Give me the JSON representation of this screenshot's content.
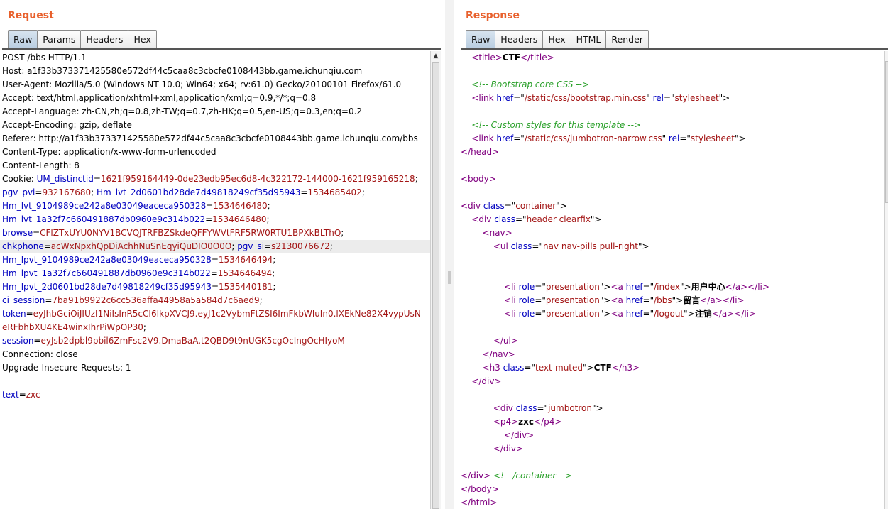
{
  "request": {
    "title": "Request",
    "tabs": [
      {
        "label": "Raw",
        "active": true
      },
      {
        "label": "Params",
        "active": false
      },
      {
        "label": "Headers",
        "active": false
      },
      {
        "label": "Hex",
        "active": false
      }
    ],
    "lines": [
      [
        {
          "t": "POST /bbs HTTP/1.1",
          "c": "plain"
        }
      ],
      [
        {
          "t": "Host: a1f33b373371425580e572df44c5caa8c3cbcfe0108443bb.game.ichunqiu.com",
          "c": "plain"
        }
      ],
      [
        {
          "t": "User-Agent: Mozilla/5.0 (Windows NT 10.0; Win64; x64; rv:61.0) Gecko/20100101 Firefox/61.0",
          "c": "plain"
        }
      ],
      [
        {
          "t": "Accept: text/html,application/xhtml+xml,application/xml;q=0.9,*/*;q=0.8",
          "c": "plain"
        }
      ],
      [
        {
          "t": "Accept-Language: zh-CN,zh;q=0.8,zh-TW;q=0.7,zh-HK;q=0.5,en-US;q=0.3,en;q=0.2",
          "c": "plain"
        }
      ],
      [
        {
          "t": "Accept-Encoding: gzip, deflate",
          "c": "plain"
        }
      ],
      [
        {
          "t": "Referer: http://a1f33b373371425580e572df44c5caa8c3cbcfe0108443bb.game.ichunqiu.com/bbs",
          "c": "plain"
        }
      ],
      [
        {
          "t": "Content-Type: application/x-www-form-urlencoded",
          "c": "plain"
        }
      ],
      [
        {
          "t": "Content-Length: 8",
          "c": "plain"
        }
      ],
      [
        {
          "t": "Cookie: ",
          "c": "plain"
        },
        {
          "t": "UM_distinctid",
          "c": "k"
        },
        {
          "t": "=",
          "c": "plain"
        },
        {
          "t": "1621f959164449-0de23edb95ec6d8-4c322172-144000-1621f959165218",
          "c": "v"
        },
        {
          "t": ";",
          "c": "plain"
        }
      ],
      [
        {
          "t": "pgv_pvi",
          "c": "k"
        },
        {
          "t": "=",
          "c": "plain"
        },
        {
          "t": "932167680",
          "c": "v"
        },
        {
          "t": "; ",
          "c": "plain"
        },
        {
          "t": "Hm_lvt_2d0601bd28de7d49818249cf35d95943",
          "c": "k"
        },
        {
          "t": "=",
          "c": "plain"
        },
        {
          "t": "1534685402",
          "c": "v"
        },
        {
          "t": ";",
          "c": "plain"
        }
      ],
      [
        {
          "t": "Hm_lvt_9104989ce242a8e03049eaceca950328",
          "c": "k"
        },
        {
          "t": "=",
          "c": "plain"
        },
        {
          "t": "1534646480",
          "c": "v"
        },
        {
          "t": ";",
          "c": "plain"
        }
      ],
      [
        {
          "t": "Hm_lvt_1a32f7c660491887db0960e9c314b022",
          "c": "k"
        },
        {
          "t": "=",
          "c": "plain"
        },
        {
          "t": "1534646480",
          "c": "v"
        },
        {
          "t": ";",
          "c": "plain"
        }
      ],
      [
        {
          "t": "browse",
          "c": "k"
        },
        {
          "t": "=",
          "c": "plain"
        },
        {
          "t": "CFlZTxUYU0NYV1BCVQJTRFBZSkdeQFFYWVtFRF5RW0RTU1BPXkBLThQ",
          "c": "v"
        },
        {
          "t": ";",
          "c": "plain"
        }
      ],
      [
        {
          "t": "chkphone",
          "c": "k"
        },
        {
          "t": "=",
          "c": "plain"
        },
        {
          "t": "acWxNpxhQpDiAchhNuSnEqyiQuDIO0O0O",
          "c": "v"
        },
        {
          "t": "; ",
          "c": "plain"
        },
        {
          "t": "pgv_si",
          "c": "k"
        },
        {
          "t": "=",
          "c": "plain"
        },
        {
          "t": "s2130076672",
          "c": "v"
        },
        {
          "t": ";",
          "c": "plain"
        }
      ],
      [
        {
          "t": "Hm_lpvt_9104989ce242a8e03049eaceca950328",
          "c": "k"
        },
        {
          "t": "=",
          "c": "plain"
        },
        {
          "t": "1534646494",
          "c": "v"
        },
        {
          "t": ";",
          "c": "plain"
        }
      ],
      [
        {
          "t": "Hm_lpvt_1a32f7c660491887db0960e9c314b022",
          "c": "k"
        },
        {
          "t": "=",
          "c": "plain"
        },
        {
          "t": "1534646494",
          "c": "v"
        },
        {
          "t": ";",
          "c": "plain"
        }
      ],
      [
        {
          "t": "Hm_lpvt_2d0601bd28de7d49818249cf35d95943",
          "c": "k"
        },
        {
          "t": "=",
          "c": "plain"
        },
        {
          "t": "1535440181",
          "c": "v"
        },
        {
          "t": ";",
          "c": "plain"
        }
      ],
      [
        {
          "t": "ci_session",
          "c": "k"
        },
        {
          "t": "=",
          "c": "plain"
        },
        {
          "t": "7ba91b9922c6cc536affa44958a5a584d7c6aed9",
          "c": "v"
        },
        {
          "t": ";",
          "c": "plain"
        }
      ],
      [
        {
          "t": "token",
          "c": "k"
        },
        {
          "t": "=",
          "c": "plain"
        },
        {
          "t": "eyJhbGciOiJIUzI1NiIsInR5cCI6IkpXVCJ9.eyJ1c2VybmFtZSI6ImFkbWluIn0.lXEkNe82X4vypUsN",
          "c": "v"
        }
      ],
      [
        {
          "t": "eRFbhbXU4KE4winxIhrPiWpOP30",
          "c": "v"
        },
        {
          "t": ";",
          "c": "plain"
        }
      ],
      [
        {
          "t": "session",
          "c": "k"
        },
        {
          "t": "=",
          "c": "plain"
        },
        {
          "t": "eyJsb2dpbl9pbil6ZmFsc2V9.DmaBaA.t2QBD9t9nUGK5cgOcIngOcHIyoM",
          "c": "v"
        }
      ],
      [
        {
          "t": "Connection: close",
          "c": "plain"
        }
      ],
      [
        {
          "t": "Upgrade-Insecure-Requests: 1",
          "c": "plain"
        }
      ],
      [
        {
          "t": "",
          "c": "plain"
        }
      ],
      [
        {
          "t": "text",
          "c": "k"
        },
        {
          "t": "=",
          "c": "plain"
        },
        {
          "t": "zxc",
          "c": "v"
        }
      ]
    ]
  },
  "response": {
    "title": "Response",
    "tabs": [
      {
        "label": "Raw",
        "active": true
      },
      {
        "label": "Headers",
        "active": false
      },
      {
        "label": "Hex",
        "active": false
      },
      {
        "label": "HTML",
        "active": false
      },
      {
        "label": "Render",
        "active": false
      }
    ],
    "lines": [
      [
        {
          "t": "    ",
          "c": "plain"
        },
        {
          "t": "<title>",
          "c": "tag"
        },
        {
          "t": "CTF",
          "c": "bold"
        },
        {
          "t": "</title>",
          "c": "tag"
        }
      ],
      [
        {
          "t": "",
          "c": "plain"
        }
      ],
      [
        {
          "t": "    ",
          "c": "plain"
        },
        {
          "t": "<!-- Bootstrap core CSS -->",
          "c": "cmt"
        }
      ],
      [
        {
          "t": "    ",
          "c": "plain"
        },
        {
          "t": "<link ",
          "c": "tag"
        },
        {
          "t": "href",
          "c": "attr"
        },
        {
          "t": "=\"",
          "c": "plain"
        },
        {
          "t": "/static/css/bootstrap.min.css",
          "c": "aval"
        },
        {
          "t": "\" ",
          "c": "plain"
        },
        {
          "t": "rel",
          "c": "attr"
        },
        {
          "t": "=\"",
          "c": "plain"
        },
        {
          "t": "stylesheet",
          "c": "aval"
        },
        {
          "t": "\">",
          "c": "plain"
        }
      ],
      [
        {
          "t": "",
          "c": "plain"
        }
      ],
      [
        {
          "t": "    ",
          "c": "plain"
        },
        {
          "t": "<!-- Custom styles for this template -->",
          "c": "cmt"
        }
      ],
      [
        {
          "t": "    ",
          "c": "plain"
        },
        {
          "t": "<link ",
          "c": "tag"
        },
        {
          "t": "href",
          "c": "attr"
        },
        {
          "t": "=\"",
          "c": "plain"
        },
        {
          "t": "/static/css/jumbotron-narrow.css",
          "c": "aval"
        },
        {
          "t": "\" ",
          "c": "plain"
        },
        {
          "t": "rel",
          "c": "attr"
        },
        {
          "t": "=\"",
          "c": "plain"
        },
        {
          "t": "stylesheet",
          "c": "aval"
        },
        {
          "t": "\">",
          "c": "plain"
        }
      ],
      [
        {
          "t": "</head>",
          "c": "tag"
        }
      ],
      [
        {
          "t": "",
          "c": "plain"
        }
      ],
      [
        {
          "t": "<body>",
          "c": "tag"
        }
      ],
      [
        {
          "t": "",
          "c": "plain"
        }
      ],
      [
        {
          "t": "<div ",
          "c": "tag"
        },
        {
          "t": "class",
          "c": "attr"
        },
        {
          "t": "=\"",
          "c": "plain"
        },
        {
          "t": "container",
          "c": "aval"
        },
        {
          "t": "\">",
          "c": "plain"
        }
      ],
      [
        {
          "t": "    ",
          "c": "plain"
        },
        {
          "t": "<div ",
          "c": "tag"
        },
        {
          "t": "class",
          "c": "attr"
        },
        {
          "t": "=\"",
          "c": "plain"
        },
        {
          "t": "header clearfix",
          "c": "aval"
        },
        {
          "t": "\">",
          "c": "plain"
        }
      ],
      [
        {
          "t": "        ",
          "c": "plain"
        },
        {
          "t": "<nav>",
          "c": "tag"
        }
      ],
      [
        {
          "t": "            ",
          "c": "plain"
        },
        {
          "t": "<ul ",
          "c": "tag"
        },
        {
          "t": "class",
          "c": "attr"
        },
        {
          "t": "=\"",
          "c": "plain"
        },
        {
          "t": "nav nav-pills pull-right",
          "c": "aval"
        },
        {
          "t": "\">",
          "c": "plain"
        }
      ],
      [
        {
          "t": "",
          "c": "plain"
        }
      ],
      [
        {
          "t": "",
          "c": "plain"
        }
      ],
      [
        {
          "t": "                ",
          "c": "plain"
        },
        {
          "t": "<li ",
          "c": "tag"
        },
        {
          "t": "role",
          "c": "attr"
        },
        {
          "t": "=\"",
          "c": "plain"
        },
        {
          "t": "presentation",
          "c": "aval"
        },
        {
          "t": "\">",
          "c": "plain"
        },
        {
          "t": "<a ",
          "c": "tag"
        },
        {
          "t": "href",
          "c": "attr"
        },
        {
          "t": "=\"",
          "c": "plain"
        },
        {
          "t": "/index",
          "c": "aval"
        },
        {
          "t": "\">",
          "c": "plain"
        },
        {
          "t": "用户中心",
          "c": "bold"
        },
        {
          "t": "</a></li>",
          "c": "tag"
        }
      ],
      [
        {
          "t": "                ",
          "c": "plain"
        },
        {
          "t": "<li ",
          "c": "tag"
        },
        {
          "t": "role",
          "c": "attr"
        },
        {
          "t": "=\"",
          "c": "plain"
        },
        {
          "t": "presentation",
          "c": "aval"
        },
        {
          "t": "\">",
          "c": "plain"
        },
        {
          "t": "<a ",
          "c": "tag"
        },
        {
          "t": "href",
          "c": "attr"
        },
        {
          "t": "=\"",
          "c": "plain"
        },
        {
          "t": "/bbs",
          "c": "aval"
        },
        {
          "t": "\">",
          "c": "plain"
        },
        {
          "t": "留言",
          "c": "bold"
        },
        {
          "t": "</a></li>",
          "c": "tag"
        }
      ],
      [
        {
          "t": "                ",
          "c": "plain"
        },
        {
          "t": "<li ",
          "c": "tag"
        },
        {
          "t": "role",
          "c": "attr"
        },
        {
          "t": "=\"",
          "c": "plain"
        },
        {
          "t": "presentation",
          "c": "aval"
        },
        {
          "t": "\">",
          "c": "plain"
        },
        {
          "t": "<a ",
          "c": "tag"
        },
        {
          "t": "href",
          "c": "attr"
        },
        {
          "t": "=\"",
          "c": "plain"
        },
        {
          "t": "/logout",
          "c": "aval"
        },
        {
          "t": "\">",
          "c": "plain"
        },
        {
          "t": "注销",
          "c": "bold"
        },
        {
          "t": "</a></li>",
          "c": "tag"
        }
      ],
      [
        {
          "t": "",
          "c": "plain"
        }
      ],
      [
        {
          "t": "            ",
          "c": "plain"
        },
        {
          "t": "</ul>",
          "c": "tag"
        }
      ],
      [
        {
          "t": "        ",
          "c": "plain"
        },
        {
          "t": "</nav>",
          "c": "tag"
        }
      ],
      [
        {
          "t": "        ",
          "c": "plain"
        },
        {
          "t": "<h3 ",
          "c": "tag"
        },
        {
          "t": "class",
          "c": "attr"
        },
        {
          "t": "=\"",
          "c": "plain"
        },
        {
          "t": "text-muted",
          "c": "aval"
        },
        {
          "t": "\">",
          "c": "plain"
        },
        {
          "t": "CTF",
          "c": "bold"
        },
        {
          "t": "</h3>",
          "c": "tag"
        }
      ],
      [
        {
          "t": "    ",
          "c": "plain"
        },
        {
          "t": "</div>",
          "c": "tag"
        }
      ],
      [
        {
          "t": "",
          "c": "plain"
        }
      ],
      [
        {
          "t": "            ",
          "c": "plain"
        },
        {
          "t": "<div ",
          "c": "tag"
        },
        {
          "t": "class",
          "c": "attr"
        },
        {
          "t": "=\"",
          "c": "plain"
        },
        {
          "t": "jumbotron",
          "c": "aval"
        },
        {
          "t": "\">",
          "c": "plain"
        }
      ],
      [
        {
          "t": "            ",
          "c": "plain"
        },
        {
          "t": "<p4>",
          "c": "tag"
        },
        {
          "t": "zxc",
          "c": "bold"
        },
        {
          "t": "</p4>",
          "c": "tag"
        }
      ],
      [
        {
          "t": "                ",
          "c": "plain"
        },
        {
          "t": "</div>",
          "c": "tag"
        }
      ],
      [
        {
          "t": "            ",
          "c": "plain"
        },
        {
          "t": "</div>",
          "c": "tag"
        }
      ],
      [
        {
          "t": "",
          "c": "plain"
        }
      ],
      [
        {
          "t": "</div> ",
          "c": "tag"
        },
        {
          "t": "<!-- /container -->",
          "c": "cmt"
        }
      ],
      [
        {
          "t": "</body>",
          "c": "tag"
        }
      ],
      [
        {
          "t": "</html>",
          "c": "tag"
        }
      ]
    ]
  }
}
